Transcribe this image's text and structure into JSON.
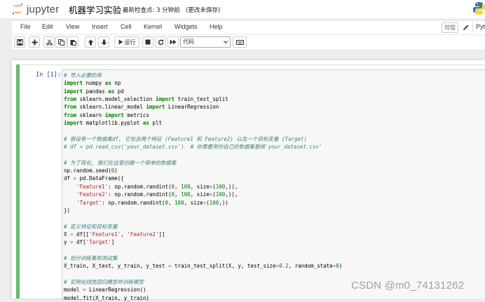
{
  "header": {
    "logo_text": "jupyter",
    "notebook_title": "机器学习实验",
    "checkpoint": "最新检查点: 3 分钟前",
    "autosave": "(更改未保存)"
  },
  "menubar": {
    "items": [
      "File",
      "Edit",
      "View",
      "Insert",
      "Cell",
      "Kernel",
      "Widgets",
      "Help"
    ],
    "trusted": "可信",
    "kernel": "Python"
  },
  "toolbar": {
    "run_label": "运行",
    "cell_type": "代码",
    "icons": [
      "save-icon",
      "plus-icon",
      "cut-icon",
      "copy-icon",
      "paste-icon",
      "arrow-up-icon",
      "arrow-down-icon",
      "play-icon",
      "stop-icon",
      "restart-icon",
      "fast-forward-icon",
      "keyboard-icon"
    ]
  },
  "cell": {
    "prompt": "In  [1]:",
    "lines": [
      [
        [
          "c-com",
          "# 导入必要的库"
        ]
      ],
      [
        [
          "c-kw",
          "import"
        ],
        [
          "",
          " numpy "
        ],
        [
          "c-kw",
          "as"
        ],
        [
          "",
          " np"
        ]
      ],
      [
        [
          "c-kw",
          "import"
        ],
        [
          "",
          " pandas "
        ],
        [
          "c-kw",
          "as"
        ],
        [
          "",
          " pd"
        ]
      ],
      [
        [
          "c-kw",
          "from"
        ],
        [
          "",
          " sklearn.model_selection "
        ],
        [
          "c-kw",
          "import"
        ],
        [
          "",
          " train_test_split"
        ]
      ],
      [
        [
          "c-kw",
          "from"
        ],
        [
          "",
          " sklearn.linear_model "
        ],
        [
          "c-kw",
          "import"
        ],
        [
          "",
          " LinearRegression"
        ]
      ],
      [
        [
          "c-kw",
          "from"
        ],
        [
          "",
          " sklearn "
        ],
        [
          "c-kw",
          "import"
        ],
        [
          "",
          " metrics"
        ]
      ],
      [
        [
          "c-kw",
          "import"
        ],
        [
          "",
          " matplotlib.pyplot "
        ],
        [
          "c-kw",
          "as"
        ],
        [
          "",
          " plt"
        ]
      ],
      [],
      [
        [
          "c-com",
          "# 假设有一个数据集df, 它包含两个特征 (Feature1 和 Feature2) 以及一个目标变量 (Target)"
        ]
      ],
      [
        [
          "c-com",
          "# df = pd.read_csv('your_dataset.csv')  # 你需要用你自己的数据集替换'your_dataset.csv'"
        ]
      ],
      [],
      [
        [
          "c-com",
          "# 为了简化, 我们在这里创建一个简单的数据集"
        ]
      ],
      [
        [
          "",
          "np.random.seed("
        ],
        [
          "c-num",
          "0"
        ],
        [
          "",
          ")"
        ]
      ],
      [
        [
          "",
          "df "
        ],
        [
          "c-op",
          "="
        ],
        [
          "",
          " pd.DataFrame({"
        ]
      ],
      [
        [
          "",
          "    "
        ],
        [
          "c-str",
          "'Feature1'"
        ],
        [
          "",
          ": np.random.randint("
        ],
        [
          "c-num",
          "0"
        ],
        [
          "",
          ", "
        ],
        [
          "c-num",
          "100"
        ],
        [
          "",
          ", size"
        ],
        [
          "c-op",
          "="
        ],
        [
          "",
          "("
        ],
        [
          "c-num",
          "100"
        ],
        [
          "",
          ",)),"
        ]
      ],
      [
        [
          "",
          "    "
        ],
        [
          "c-str",
          "'Feature2'"
        ],
        [
          "",
          ": np.random.randint("
        ],
        [
          "c-num",
          "0"
        ],
        [
          "",
          ", "
        ],
        [
          "c-num",
          "100"
        ],
        [
          "",
          ", size"
        ],
        [
          "c-op",
          "="
        ],
        [
          "",
          "("
        ],
        [
          "c-num",
          "100"
        ],
        [
          "",
          ",)),"
        ]
      ],
      [
        [
          "",
          "    "
        ],
        [
          "c-str",
          "'Target'"
        ],
        [
          "",
          ": np.random.randint("
        ],
        [
          "c-num",
          "0"
        ],
        [
          "",
          ", "
        ],
        [
          "c-num",
          "100"
        ],
        [
          "",
          ", size"
        ],
        [
          "c-op",
          "="
        ],
        [
          "",
          "("
        ],
        [
          "c-num",
          "100"
        ],
        [
          "",
          ",))"
        ]
      ],
      [
        [
          "",
          "})"
        ]
      ],
      [],
      [
        [
          "c-com",
          "# 定义特征和目标变量"
        ]
      ],
      [
        [
          "",
          "X "
        ],
        [
          "c-op",
          "="
        ],
        [
          "",
          " df[["
        ],
        [
          "c-str",
          "'Feature1'"
        ],
        [
          "",
          ", "
        ],
        [
          "c-str",
          "'Feature2'"
        ],
        [
          "",
          "]]"
        ]
      ],
      [
        [
          "",
          "y "
        ],
        [
          "c-op",
          "="
        ],
        [
          "",
          " df["
        ],
        [
          "c-str",
          "'Target'"
        ],
        [
          "",
          "]"
        ]
      ],
      [],
      [
        [
          "c-com",
          "# 划分训练集和测试集"
        ]
      ],
      [
        [
          "",
          "X_train, X_test, y_train, y_test "
        ],
        [
          "c-op",
          "="
        ],
        [
          "",
          " train_test_split(X, y, test_size"
        ],
        [
          "c-op",
          "="
        ],
        [
          "c-num",
          "0.2"
        ],
        [
          "",
          ", random_state"
        ],
        [
          "c-op",
          "="
        ],
        [
          "c-num",
          "0"
        ],
        [
          "",
          ")"
        ]
      ],
      [],
      [
        [
          "c-com",
          "# 实例化线性回归模型并训练模型"
        ]
      ],
      [
        [
          "",
          "model "
        ],
        [
          "c-op",
          "="
        ],
        [
          "",
          " LinearRegression()"
        ]
      ],
      [
        [
          "",
          "model.fit(X_train, y_train)"
        ]
      ]
    ]
  },
  "watermark": "CSDN @m0_74131262",
  "colors": {
    "logo_orange": "#f37726",
    "cell_selected": "#66bb6a",
    "prompt_blue": "#303f9f",
    "comment": "#408080",
    "keyword": "#008000",
    "string": "#ba2121"
  }
}
